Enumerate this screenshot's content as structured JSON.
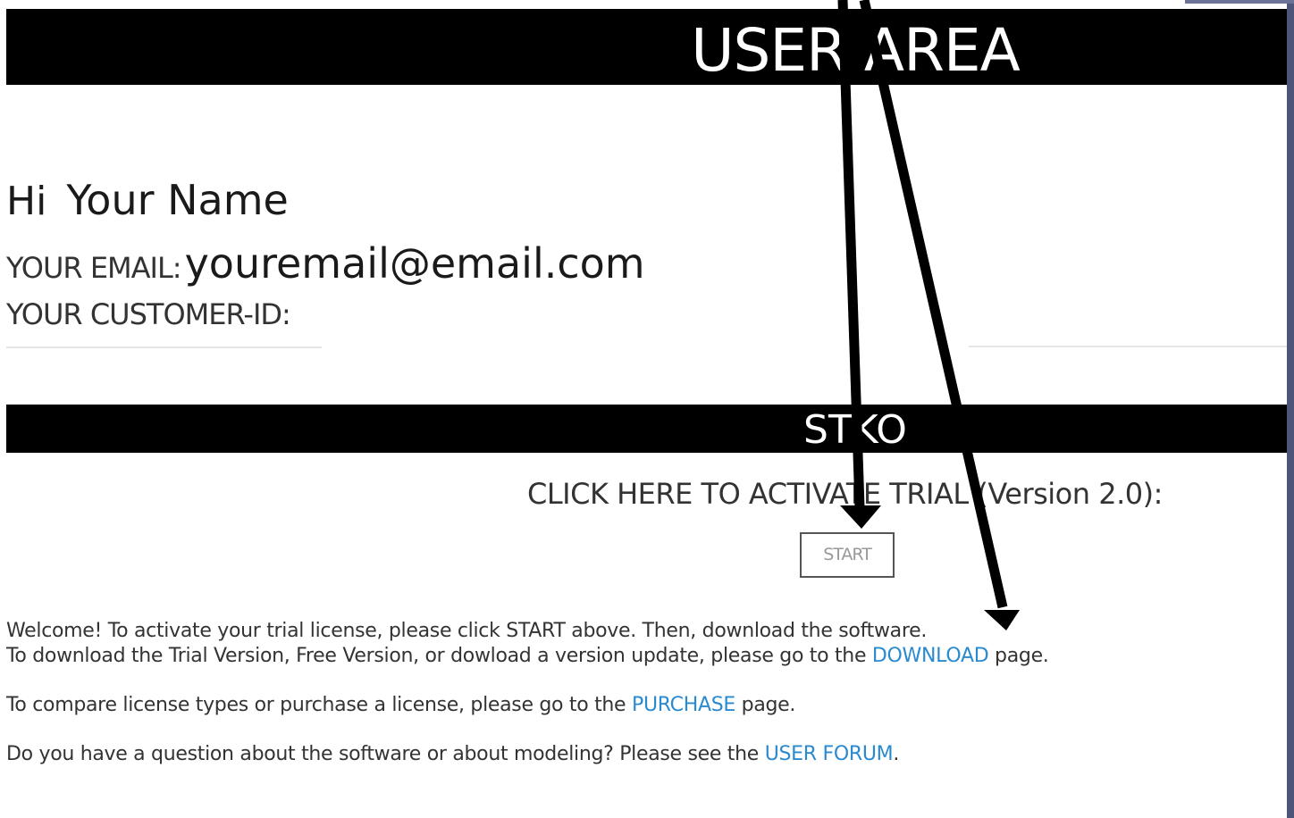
{
  "header": {
    "title": "USER AREA"
  },
  "user": {
    "greeting": "Hi",
    "name": "Your Name",
    "email_label": "YOUR EMAIL:",
    "email": "youremail@email.com",
    "customer_id_label": "YOUR CUSTOMER-ID:"
  },
  "product": {
    "title": "STKO",
    "activate_prompt": "CLICK HERE TO ACTIVATE TRIAL (Version 2.0):",
    "start_label": "START"
  },
  "info": {
    "line1": "Welcome! To activate your trial license, please click START above. Then, download the software.",
    "line2_pre": "To download the Trial Version, Free Version, or dowload a version update, please go to the ",
    "line2_link": "DOWNLOAD",
    "line2_post": " page.",
    "line3_pre": "To compare license types or purchase a license, please go to the ",
    "line3_link": "PURCHASE",
    "line3_post": " page.",
    "line4_pre": "Do you have a question about the software or about modeling? Please see the ",
    "line4_link": "USER FORUM",
    "line4_post": "."
  },
  "colors": {
    "banner": "#000000",
    "link": "#2a8ad0",
    "annotation_arrow": "#000000"
  },
  "annotations": {
    "arrows": [
      "arrow-to-start-icon",
      "arrow-to-download-icon"
    ]
  }
}
